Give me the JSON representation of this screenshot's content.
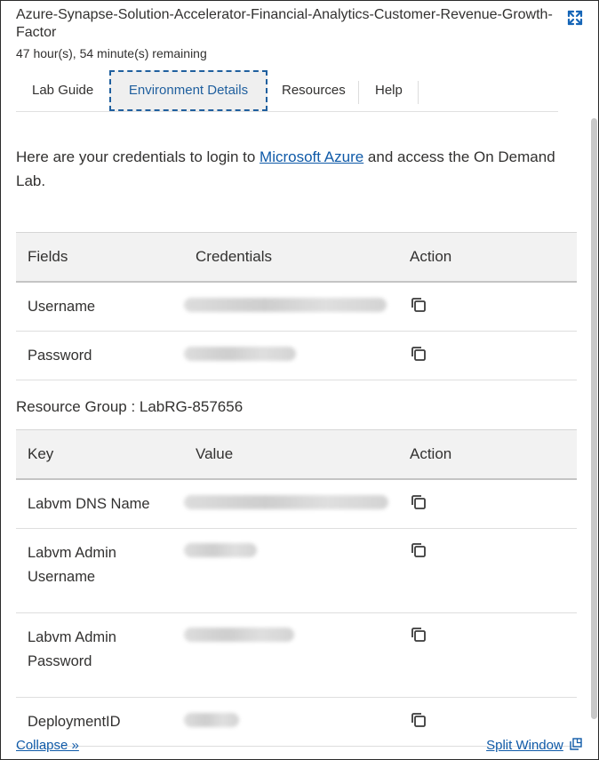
{
  "header": {
    "title": "Azure-Synapse-Solution-Accelerator-Financial-Analytics-Customer-Revenue-Growth-Factor",
    "remaining": "47 hour(s), 54 minute(s) remaining",
    "expand_icon": "expand-icon"
  },
  "tabs": [
    {
      "label": "Lab Guide",
      "active": false
    },
    {
      "label": "Environment Details",
      "active": true
    },
    {
      "label": "Resources",
      "active": false
    },
    {
      "label": "Help",
      "active": false
    }
  ],
  "intro": {
    "before": "Here are your credentials to login to ",
    "link": "Microsoft Azure",
    "after": " and access the On Demand Lab."
  },
  "credentials_table": {
    "headers": [
      "Fields",
      "Credentials",
      "Action"
    ],
    "rows": [
      {
        "field": "Username",
        "value": "[redacted]"
      },
      {
        "field": "Password",
        "value": "[redacted]"
      }
    ]
  },
  "resource_group": {
    "label": "Resource Group : LabRG-857656"
  },
  "resource_table": {
    "headers": [
      "Key",
      "Value",
      "Action"
    ],
    "rows": [
      {
        "key": "Labvm DNS Name",
        "value": "[redacted]"
      },
      {
        "key": "Labvm Admin Username",
        "value": "[redacted]"
      },
      {
        "key": "Labvm Admin Password",
        "value": "[redacted]"
      },
      {
        "key": "DeploymentID",
        "value": "[redacted]"
      }
    ]
  },
  "footer": {
    "collapse": "Collapse »",
    "split_window": "Split Window"
  },
  "colors": {
    "link": "#0f5aa8",
    "active_tab_border": "#1f5f9e",
    "header_bg": "#f2f2f2"
  }
}
